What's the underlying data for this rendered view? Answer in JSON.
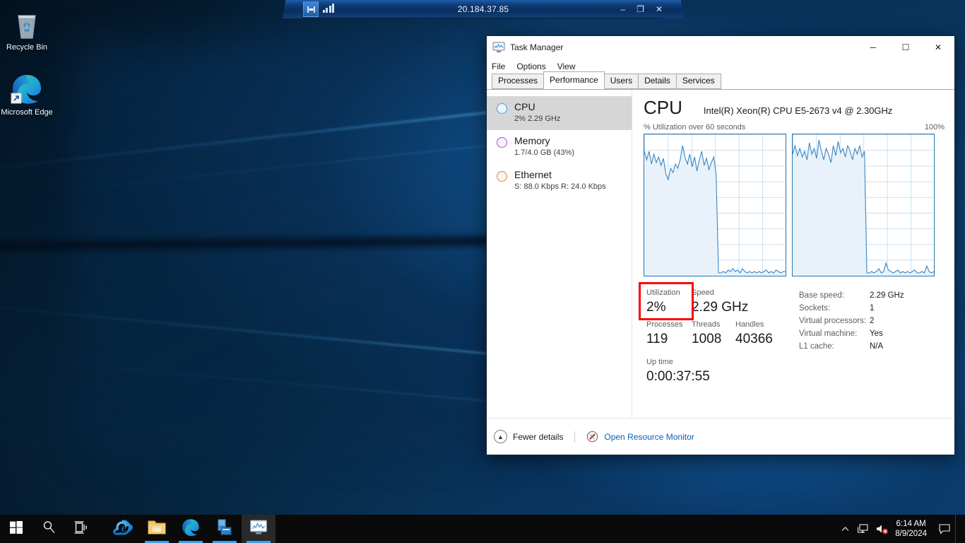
{
  "desktop": {
    "icons": [
      {
        "name": "recycle-bin",
        "label": "Recycle Bin"
      },
      {
        "name": "microsoft-edge",
        "label": "Microsoft Edge"
      }
    ]
  },
  "rdp_bar": {
    "host": "20.184.37.85",
    "pin_icon": "pin-icon",
    "signal_icon": "signal-strength-icon",
    "minimize": "–",
    "restore": "❐",
    "close": "✕"
  },
  "task_manager": {
    "title": "Task Manager",
    "window_buttons": {
      "minimize": "─",
      "maximize": "☐",
      "close": "✕"
    },
    "menu": [
      "File",
      "Options",
      "View"
    ],
    "tabs": [
      {
        "label": "Processes",
        "active": false
      },
      {
        "label": "Performance",
        "active": true
      },
      {
        "label": "Users",
        "active": false
      },
      {
        "label": "Details",
        "active": false
      },
      {
        "label": "Services",
        "active": false
      }
    ],
    "sidebar": [
      {
        "name": "CPU",
        "sub": "2%  2.29 GHz",
        "color": "#4a9fd8",
        "selected": true
      },
      {
        "name": "Memory",
        "sub": "1.7/4.0 GB (43%)",
        "color": "#b34bc4",
        "selected": false
      },
      {
        "name": "Ethernet",
        "sub_prefix_s": "S:",
        "sub_s": " 88.0 Kbps ",
        "sub_prefix_r": "R:",
        "sub_r": " 24.0 Kbps",
        "sub": "S: 88.0 Kbps R: 24.0 Kbps",
        "color": "#d38a3f",
        "selected": false
      }
    ],
    "header": {
      "title": "CPU",
      "model": "Intel(R) Xeon(R) CPU E5-2673 v4 @ 2.30GHz"
    },
    "graph_caption_left": "% Utilization over 60 seconds",
    "graph_caption_right": "100%",
    "stats": {
      "utilization_label": "Utilization",
      "utilization_value": "2%",
      "speed_label": "Speed",
      "speed_value": "2.29 GHz",
      "processes_label": "Processes",
      "processes_value": "119",
      "threads_label": "Threads",
      "threads_value": "1008",
      "handles_label": "Handles",
      "handles_value": "40366",
      "uptime_label": "Up time",
      "uptime_value": "0:00:37:55"
    },
    "details": [
      {
        "key": "Base speed:",
        "value": "2.29 GHz"
      },
      {
        "key": "Sockets:",
        "value": "1"
      },
      {
        "key": "Virtual processors:",
        "value": "2"
      },
      {
        "key": "Virtual machine:",
        "value": "Yes"
      },
      {
        "key": "L1 cache:",
        "value": "N/A"
      }
    ],
    "footer": {
      "fewer_details": "Fewer details",
      "resource_monitor": "Open Resource Monitor"
    },
    "highlight_color": "#ff0000"
  },
  "chart_data": [
    {
      "type": "area",
      "title": "CPU 0 — % Utilization over 60 seconds",
      "xlabel": "60 seconds",
      "ylabel": "% Utilization",
      "ylim": [
        0,
        100
      ],
      "grid": true,
      "accent": "#3b86c2",
      "values": [
        88,
        82,
        88,
        79,
        86,
        80,
        84,
        78,
        83,
        72,
        68,
        76,
        73,
        79,
        76,
        82,
        92,
        84,
        79,
        86,
        77,
        84,
        74,
        82,
        88,
        78,
        83,
        75,
        80,
        84,
        72,
        2,
        2,
        3,
        2,
        4,
        3,
        5,
        3,
        4,
        2,
        5,
        3,
        2,
        3,
        2,
        3,
        2,
        3,
        2,
        3,
        4,
        2,
        3,
        2,
        4,
        3,
        2,
        3,
        3
      ]
    },
    {
      "type": "area",
      "title": "CPU 1 — % Utilization over 60 seconds",
      "xlabel": "60 seconds",
      "ylabel": "% Utilization",
      "ylim": [
        0,
        100
      ],
      "grid": true,
      "accent": "#3b86c2",
      "values": [
        86,
        92,
        85,
        90,
        84,
        88,
        82,
        94,
        86,
        90,
        83,
        96,
        88,
        82,
        90,
        86,
        80,
        92,
        85,
        95,
        87,
        90,
        84,
        92,
        88,
        82,
        90,
        86,
        92,
        84,
        88,
        2,
        2,
        3,
        2,
        3,
        5,
        2,
        3,
        9,
        4,
        3,
        2,
        3,
        4,
        2,
        3,
        2,
        3,
        2,
        3,
        4,
        2,
        2,
        3,
        2,
        7,
        3,
        2,
        3
      ]
    }
  ],
  "taskbar": {
    "start": "start-icon",
    "search": "search-icon",
    "task_view": "task-view-icon",
    "apps": [
      {
        "name": "internet-explorer",
        "active": false
      },
      {
        "name": "file-explorer",
        "active": false
      },
      {
        "name": "microsoft-edge",
        "active": false
      },
      {
        "name": "server-manager",
        "active": false
      },
      {
        "name": "task-manager",
        "active": true
      }
    ],
    "tray": {
      "show_hidden": "chevron-up-icon",
      "network": "network-icon",
      "volume": "volume-muted-icon",
      "time": "6:14 AM",
      "date": "8/9/2024",
      "action_center": "action-center-icon"
    }
  }
}
